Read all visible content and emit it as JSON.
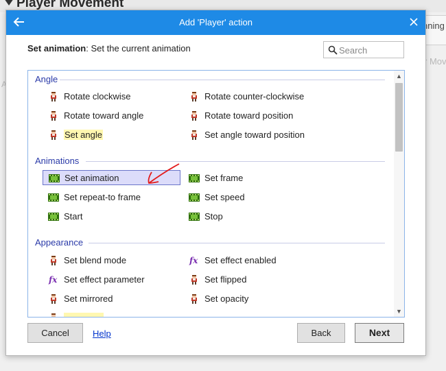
{
  "background": {
    "event_title": "Player Movement",
    "right_text": "nning",
    "right_faded": "r Mov",
    "left_faded": "A"
  },
  "dialog": {
    "title": "Add 'Player' action",
    "back_icon": "arrow-left-icon",
    "close_icon": "close-icon",
    "description_bold": "Set animation",
    "description_rest": ": Set the current animation",
    "search_placeholder": "Search",
    "groups": [
      {
        "title": "Angle",
        "items": [
          {
            "label": "Rotate clockwise",
            "icon": "sprite-icon"
          },
          {
            "label": "Rotate counter-clockwise",
            "icon": "sprite-icon"
          },
          {
            "label": "Rotate toward angle",
            "icon": "sprite-icon"
          },
          {
            "label": "Rotate toward position",
            "icon": "sprite-icon"
          },
          {
            "label": "Set angle",
            "icon": "sprite-icon",
            "highlight": true
          },
          {
            "label": "Set angle toward position",
            "icon": "sprite-icon"
          }
        ]
      },
      {
        "title": "Animations",
        "items": [
          {
            "label": "Set animation",
            "icon": "film-icon",
            "selected": true
          },
          {
            "label": "Set frame",
            "icon": "film-icon"
          },
          {
            "label": "Set repeat-to frame",
            "icon": "film-icon"
          },
          {
            "label": "Set speed",
            "icon": "film-icon"
          },
          {
            "label": "Start",
            "icon": "film-icon"
          },
          {
            "label": "Stop",
            "icon": "film-icon"
          }
        ]
      },
      {
        "title": "Appearance",
        "items": [
          {
            "label": "Set blend mode",
            "icon": "sprite-icon"
          },
          {
            "label": "Set effect enabled",
            "icon": "fx-icon"
          },
          {
            "label": "Set effect parameter",
            "icon": "fx-icon"
          },
          {
            "label": "Set flipped",
            "icon": "sprite-icon"
          },
          {
            "label": "Set mirrored",
            "icon": "sprite-icon"
          },
          {
            "label": "Set opacity",
            "icon": "sprite-icon"
          }
        ]
      }
    ],
    "buttons": {
      "cancel": "Cancel",
      "help": "Help",
      "back": "Back",
      "next": "Next"
    },
    "colors": {
      "titlebar": "#1e8ae6",
      "group_title": "#2a3aa8",
      "highlight": "#fff7b0",
      "selected_bg": "#dcdcfa",
      "annotation_arrow": "#e31b1b"
    }
  }
}
